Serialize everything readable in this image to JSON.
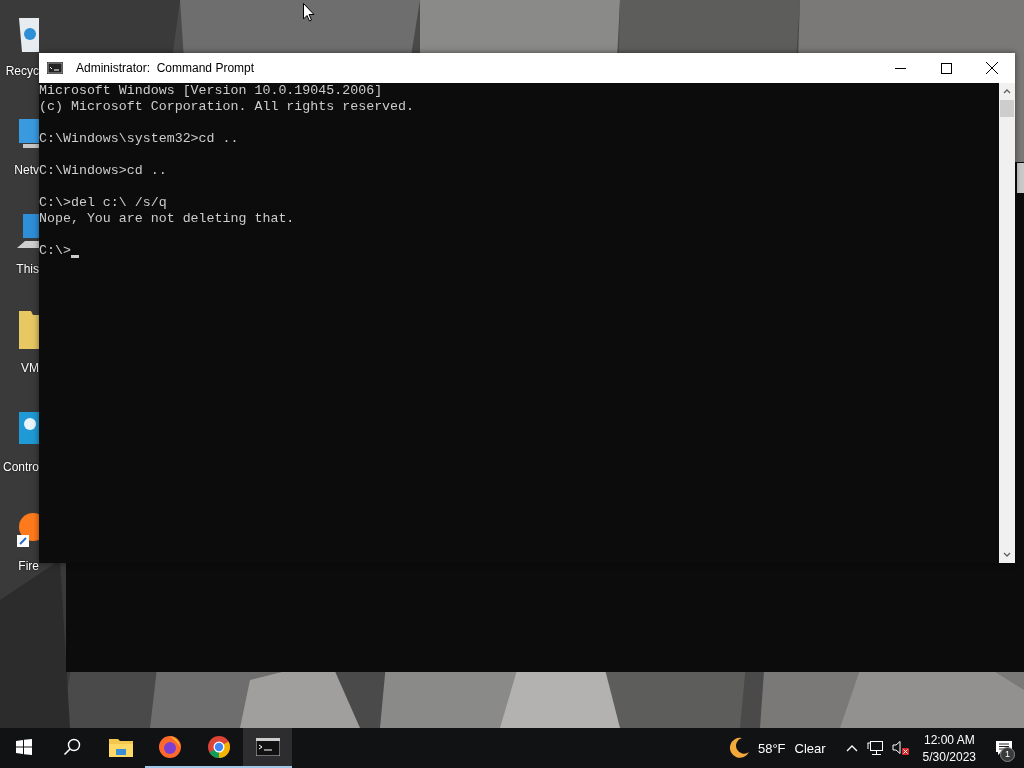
{
  "desktop_icons": [
    {
      "kind": "recycle",
      "label": "Recyc"
    },
    {
      "kind": "network",
      "label": "Netv"
    },
    {
      "kind": "pc",
      "label": "This"
    },
    {
      "kind": "folder",
      "label": "VM"
    },
    {
      "kind": "control",
      "label": "Contro"
    },
    {
      "kind": "firefox",
      "label": "Fire"
    }
  ],
  "window": {
    "title": "Administrator:  Command Prompt",
    "cursor": true,
    "blocks": [
      [
        "Microsoft Windows [Version 10.0.19045.2006]",
        "(c) Microsoft Corporation. All rights reserved."
      ],
      [
        "C:\\Windows\\system32>cd .."
      ],
      [
        "C:\\Windows>cd .."
      ],
      [
        "C:\\>del c:\\ /s/q",
        "Nope, You are not deleting that."
      ],
      [
        "C:\\>"
      ]
    ]
  },
  "taskbar": {
    "apps": [
      {
        "kind": "explorer",
        "running": false,
        "selected": false
      },
      {
        "kind": "firefox",
        "running": true,
        "selected": false
      },
      {
        "kind": "chrome",
        "running": true,
        "selected": false
      },
      {
        "kind": "cmd",
        "running": true,
        "selected": true
      }
    ],
    "weather": {
      "temperature": "58°F",
      "condition": "Clear"
    },
    "time": "12:00 AM",
    "date": "5/30/2023",
    "notifications": "1"
  }
}
